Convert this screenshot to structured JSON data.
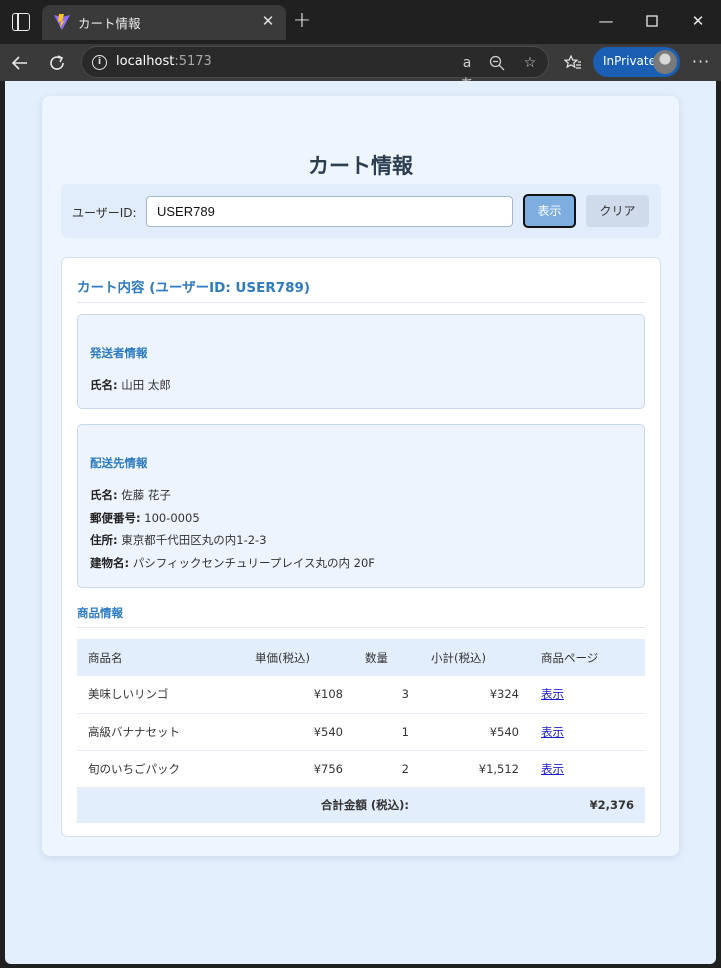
{
  "browser": {
    "tab_title": "カート情報",
    "url_host": "localhost",
    "url_port": ":5173",
    "inprivate_label": "InPrivate"
  },
  "page": {
    "title": "カート情報"
  },
  "search": {
    "label": "ユーザーID:",
    "value": "USER789",
    "show_button": "表示",
    "clear_button": "クリア"
  },
  "cart": {
    "heading": "カート内容 (ユーザーID: USER789)",
    "sender": {
      "title": "発送者情報",
      "name_label": "氏名:",
      "name_value": "山田 太郎"
    },
    "recipient": {
      "title": "配送先情報",
      "name_label": "氏名:",
      "name_value": "佐藤 花子",
      "postal_label": "郵便番号:",
      "postal_value": "100-0005",
      "address_label": "住所:",
      "address_value": "東京都千代田区丸の内1-2-3",
      "building_label": "建物名:",
      "building_value": "パシフィックセンチュリープレイス丸の内 20F"
    },
    "products": {
      "title": "商品情報",
      "columns": [
        "商品名",
        "単価(税込)",
        "数量",
        "小計(税込)",
        "商品ページ"
      ],
      "rows": [
        {
          "name": "美味しいリンゴ",
          "price": "¥108",
          "qty": "3",
          "subtotal": "¥324",
          "link": "表示"
        },
        {
          "name": "高級バナナセット",
          "price": "¥540",
          "qty": "1",
          "subtotal": "¥540",
          "link": "表示"
        },
        {
          "name": "旬のいちごパック",
          "price": "¥756",
          "qty": "2",
          "subtotal": "¥1,512",
          "link": "表示"
        }
      ],
      "total_label": "合計金額 (税込):",
      "total_value": "¥2,376"
    }
  }
}
